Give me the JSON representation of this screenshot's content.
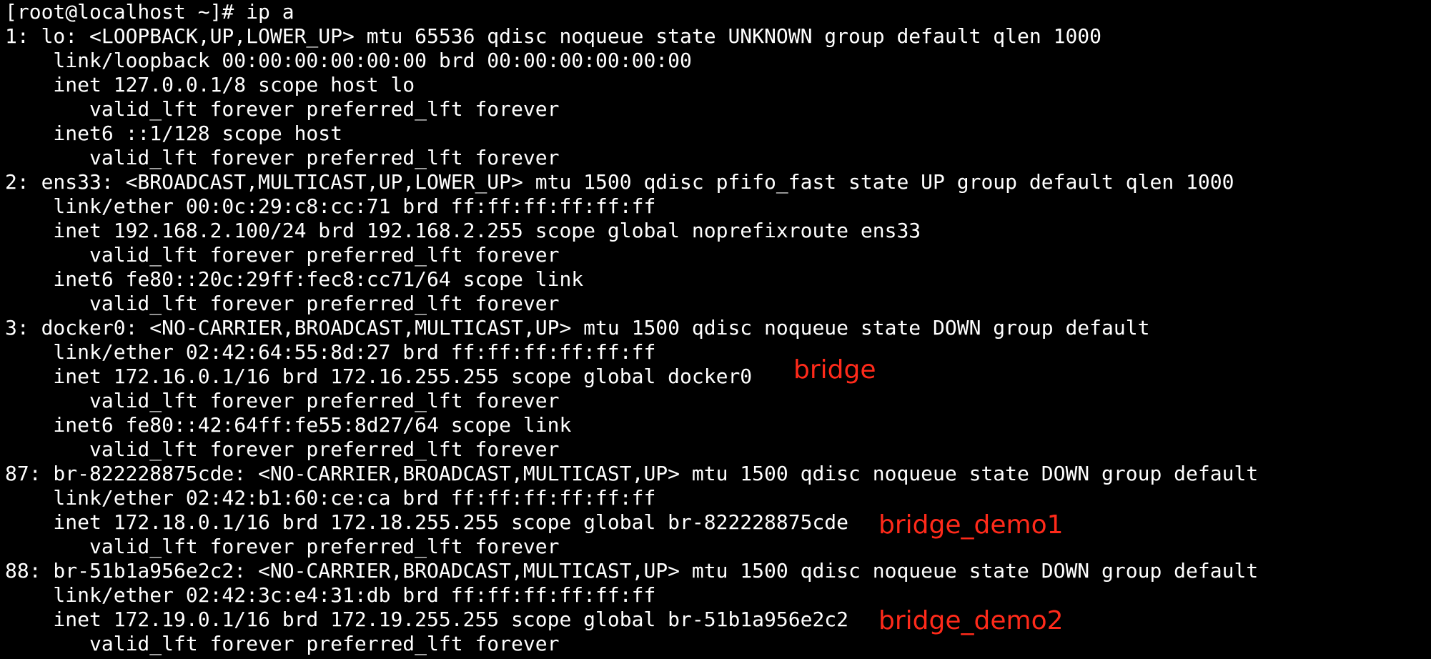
{
  "terminal": {
    "text_color": "#ffffff",
    "background_color": "#000000",
    "annotation_color": "#ff2a1a",
    "lines": [
      "[root@localhost ~]# ip a",
      "1: lo: <LOOPBACK,UP,LOWER_UP> mtu 65536 qdisc noqueue state UNKNOWN group default qlen 1000",
      "    link/loopback 00:00:00:00:00:00 brd 00:00:00:00:00:00",
      "    inet 127.0.0.1/8 scope host lo",
      "       valid_lft forever preferred_lft forever",
      "    inet6 ::1/128 scope host",
      "       valid_lft forever preferred_lft forever",
      "2: ens33: <BROADCAST,MULTICAST,UP,LOWER_UP> mtu 1500 qdisc pfifo_fast state UP group default qlen 1000",
      "    link/ether 00:0c:29:c8:cc:71 brd ff:ff:ff:ff:ff:ff",
      "    inet 192.168.2.100/24 brd 192.168.2.255 scope global noprefixroute ens33",
      "       valid_lft forever preferred_lft forever",
      "    inet6 fe80::20c:29ff:fec8:cc71/64 scope link",
      "       valid_lft forever preferred_lft forever",
      "3: docker0: <NO-CARRIER,BROADCAST,MULTICAST,UP> mtu 1500 qdisc noqueue state DOWN group default",
      "    link/ether 02:42:64:55:8d:27 brd ff:ff:ff:ff:ff:ff",
      "    inet 172.16.0.1/16 brd 172.16.255.255 scope global docker0",
      "       valid_lft forever preferred_lft forever",
      "    inet6 fe80::42:64ff:fe55:8d27/64 scope link",
      "       valid_lft forever preferred_lft forever",
      "87: br-822228875cde: <NO-CARRIER,BROADCAST,MULTICAST,UP> mtu 1500 qdisc noqueue state DOWN group default",
      "    link/ether 02:42:b1:60:ce:ca brd ff:ff:ff:ff:ff:ff",
      "    inet 172.18.0.1/16 brd 172.18.255.255 scope global br-822228875cde",
      "       valid_lft forever preferred_lft forever",
      "88: br-51b1a956e2c2: <NO-CARRIER,BROADCAST,MULTICAST,UP> mtu 1500 qdisc noqueue state DOWN group default",
      "    link/ether 02:42:3c:e4:31:db brd ff:ff:ff:ff:ff:ff",
      "    inet 172.19.0.1/16 brd 172.19.255.255 scope global br-51b1a956e2c2",
      "       valid_lft forever preferred_lft forever"
    ],
    "annotations": {
      "bridge": "bridge",
      "bridge_demo1": "bridge_demo1",
      "bridge_demo2": "bridge_demo2"
    }
  }
}
